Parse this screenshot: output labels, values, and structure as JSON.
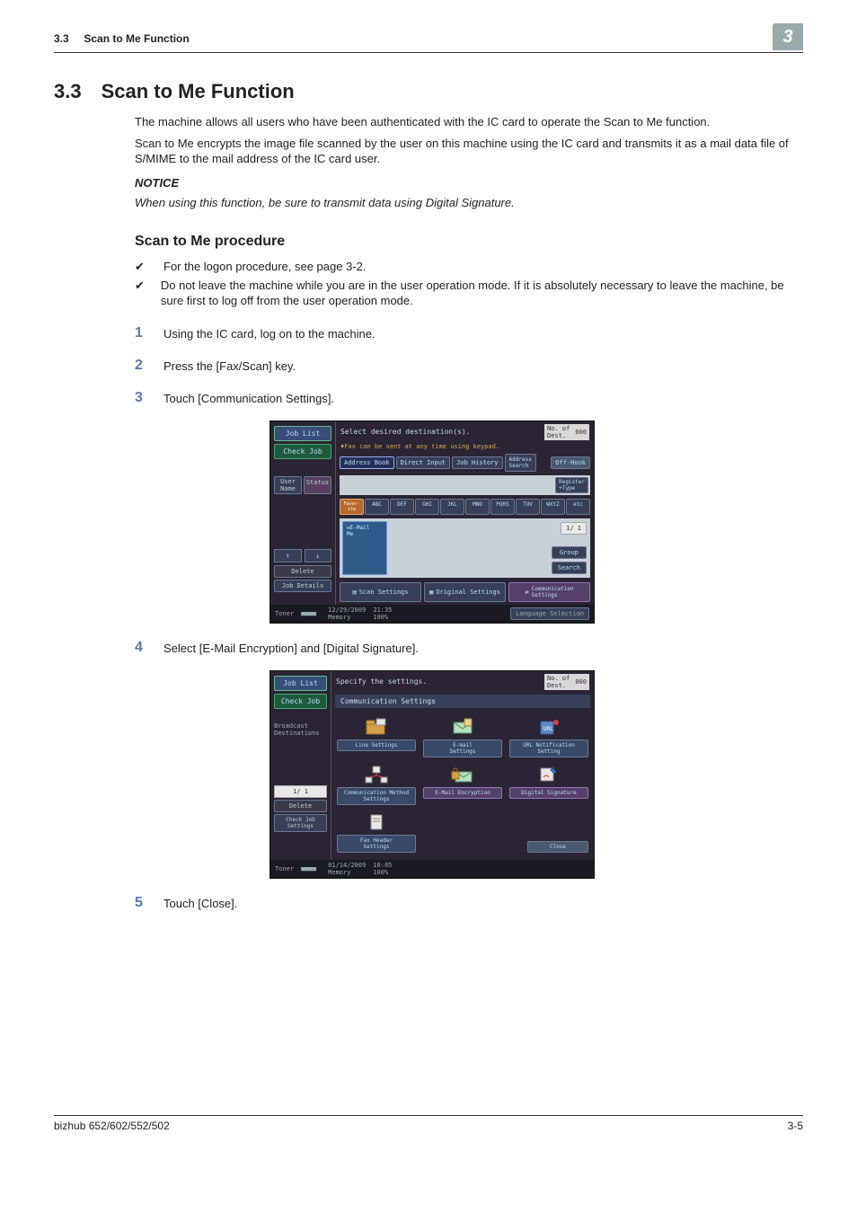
{
  "header": {
    "section_num_small": "3.3",
    "section_title_small": "Scan to Me Function",
    "chapter_badge": "3"
  },
  "title": {
    "num": "3.3",
    "name": "Scan to Me Function"
  },
  "paras": {
    "p1": "The machine allows all users who have been authenticated with the IC card to operate the Scan to Me function.",
    "p2": "Scan to Me encrypts the image file scanned by the user on this machine using the IC card and transmits it as a mail data file of S/MIME to the mail address of the IC card user.",
    "notice_label": "NOTICE",
    "notice_text": "When using this function, be sure to transmit data using Digital Signature."
  },
  "sub": "Scan to Me procedure",
  "checks": {
    "c1": "For the logon procedure, see page 3-2.",
    "c2": "Do not leave the machine while you are in the user operation mode. If it is absolutely necessary to leave the machine, be sure first to log off from the user operation mode."
  },
  "steps": {
    "s1": {
      "num": "1",
      "text": "Using the IC card, log on to the machine."
    },
    "s2": {
      "num": "2",
      "text": "Press the [Fax/Scan] key."
    },
    "s3": {
      "num": "3",
      "text": "Touch [Communication Settings]."
    },
    "s4": {
      "num": "4",
      "text": "Select [E-Mail Encryption] and [Digital Signature]."
    },
    "s5": {
      "num": "5",
      "text": "Touch [Close]."
    }
  },
  "panel1": {
    "side": {
      "job_list": "Job List",
      "check_job": "Check Job",
      "user_name": "User\nName",
      "status": "Status",
      "delete": "Delete",
      "job_details": "Job Details"
    },
    "info": "Select desired destination(s).",
    "sub_info": "Fax can be sent at any time using keypad.",
    "dest_label": "No. of\nDest.",
    "dest_value": "000",
    "tabs": {
      "address_book": "Address Book",
      "direct_input": "Direct Input",
      "job_history": "Job History",
      "address_search": "Address\nSearch",
      "off_hook": "Off-Hook"
    },
    "strip_btn": "Register\n+Type",
    "alpha": [
      "Favor-\nite",
      "ABC",
      "DEF",
      "GHI",
      "JKL",
      "MNO",
      "PQRS",
      "TUV",
      "WXYZ",
      "etc"
    ],
    "email_chip": "E-Mail\nMe",
    "page_ind": "1/  1",
    "right_btns": {
      "group": "Group",
      "search": "Search"
    },
    "bottom": {
      "scan": "Scan Settings",
      "original": "Original Settings",
      "comm": "Communication\nSettings"
    },
    "status": {
      "toner": "Toner",
      "date": "12/29/2009",
      "time": "21:35",
      "memory": "Memory",
      "memval": "100%",
      "lang": "Language Selection"
    }
  },
  "panel2": {
    "side": {
      "job_list": "Job List",
      "check_job": "Check Job",
      "broadcast": "Broadcast\nDestinations",
      "page": "1/  1",
      "delete": "Delete",
      "check_settings": "Check Job\nSettings"
    },
    "info": "Specify the settings.",
    "dest_label": "No. of\nDest.",
    "dest_value": "000",
    "title_bar": "Communication Settings",
    "icons": {
      "line": "Line Settings",
      "email": "E-mail\nSettings",
      "url": "URL Notification\nSetting",
      "method": "Communication Method\nSettings",
      "encrypt": "E-Mail Encryption",
      "signature": "Digital Signature",
      "fax_header": "Fax Header\nSettings"
    },
    "status": {
      "toner": "Toner",
      "date": "01/14/2009",
      "time": "10:05",
      "memory": "Memory",
      "memval": "100%",
      "close": "Close"
    }
  },
  "footer": {
    "left": "bizhub 652/602/552/502",
    "right": "3-5"
  }
}
